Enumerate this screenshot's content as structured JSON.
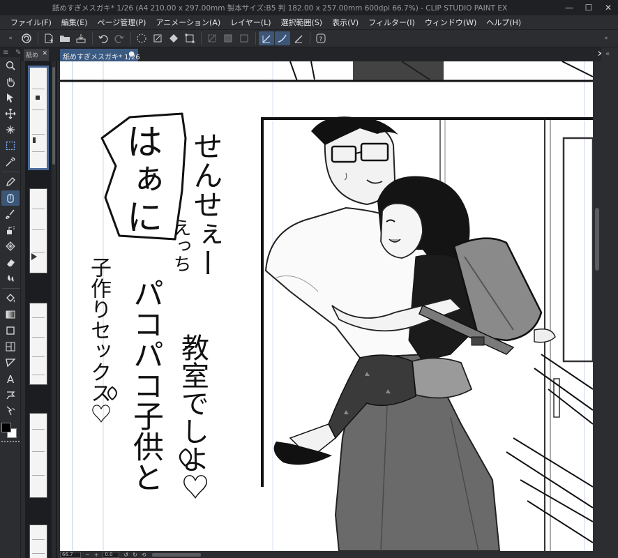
{
  "window": {
    "title": "舐めすぎメスガキ* 1/26 (A4 210.00 x 297.00mm 製本サイズ:B5 判 182.00 x 257.00mm 600dpi 66.7%) - CLIP STUDIO PAINT EX",
    "min": "—",
    "max": "☐",
    "close": "✕"
  },
  "menu": [
    "ファイル(F)",
    "編集(E)",
    "ページ管理(P)",
    "アニメーション(A)",
    "レイヤー(L)",
    "選択範囲(S)",
    "表示(V)",
    "フィルター(I)",
    "ウィンドウ(W)",
    "ヘルプ(H)"
  ],
  "tabs": {
    "nav_tab_label": "舐め",
    "doc_tab_label": "舐めすぎメスガキ* 1/26",
    "doc_tab_dot": "●",
    "close_tab": "✕"
  },
  "status": {
    "zoom": "66.7",
    "angle": "0.0"
  },
  "manga_text": {
    "balloon": "はぁに",
    "line1": "せんせぇー",
    "line2": "えっち",
    "line3": "子作りセックス♡",
    "line4": "パコパコ子供と",
    "line5": "教室でしよ♡"
  },
  "colors": {
    "accent": "#3e5675",
    "doc_tab": "#3a5a82",
    "fg_color": "#000000",
    "bg_color": "#ffffff"
  }
}
